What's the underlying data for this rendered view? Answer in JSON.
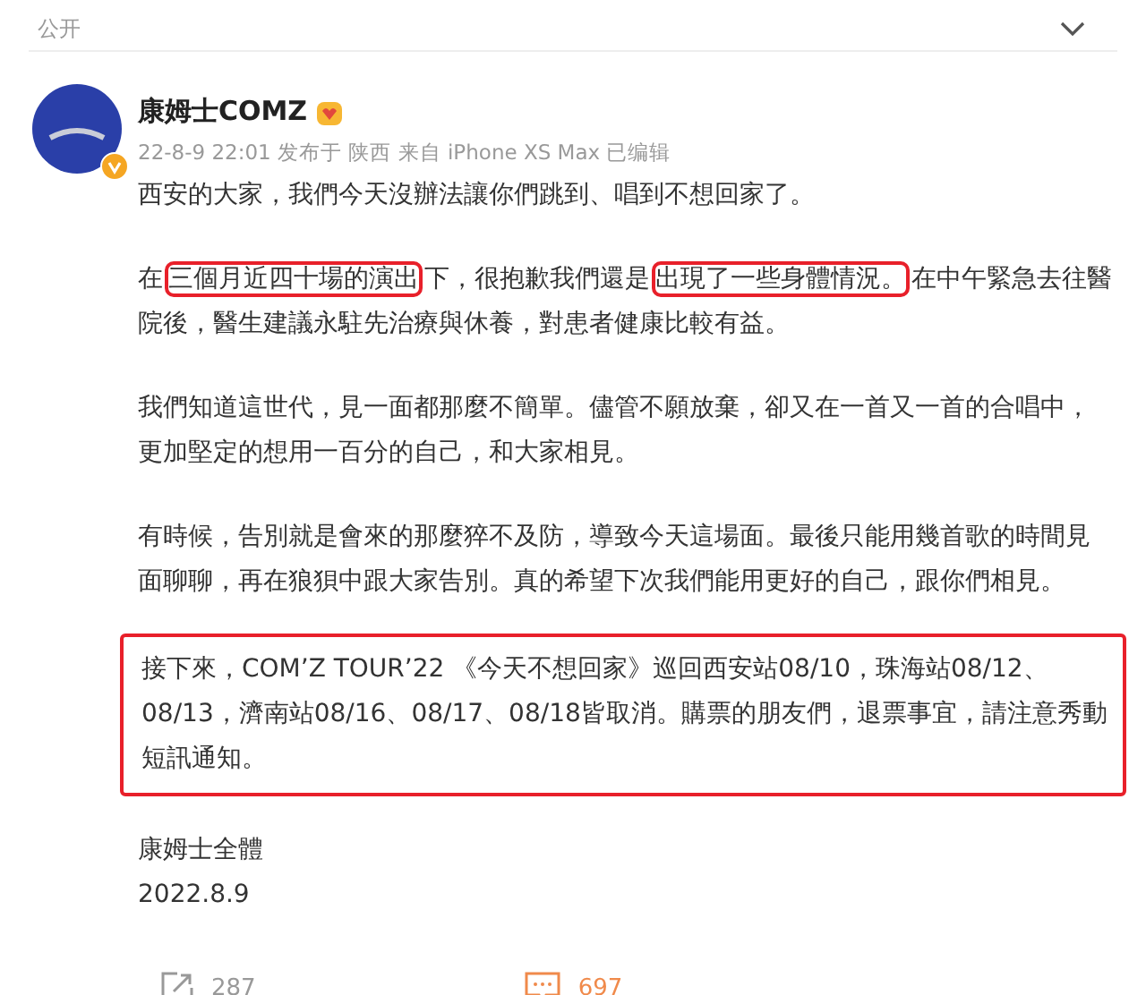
{
  "header": {
    "label": "公开"
  },
  "post": {
    "author": "康姆士COMZ",
    "meta": "22-8-9 22:01 发布于 陕西 来自 iPhone XS Max 已编辑",
    "paragraphs": [
      {
        "boxed": false,
        "segments": [
          {
            "text": "西安的大家，我們今天沒辦法讓你們跳到、唱到不想回家了。",
            "boxed": false
          }
        ]
      },
      {
        "boxed": false,
        "segments": [
          {
            "text": "在",
            "boxed": false
          },
          {
            "text": "三個月近四十場的演出",
            "boxed": true
          },
          {
            "text": "下，很抱歉我們還是",
            "boxed": false
          },
          {
            "text": "出現了一些身體情況。",
            "boxed": true
          },
          {
            "text": "在中午緊急去往醫院後，醫生建議永駐先治療與休養，對患者健康比較有益。",
            "boxed": false
          }
        ]
      },
      {
        "boxed": false,
        "segments": [
          {
            "text": "我們知道這世代，見一面都那麼不簡單。儘管不願放棄，卻又在一首又一首的合唱中，更加堅定的想用一百分的自己，和大家相見。",
            "boxed": false
          }
        ]
      },
      {
        "boxed": false,
        "segments": [
          {
            "text": "有時候，告別就是會來的那麼猝不及防，導致今天這場面。最後只能用幾首歌的時間見面聊聊，再在狼狽中跟大家告別。真的希望下次我們能用更好的自己，跟你們相見。",
            "boxed": false
          }
        ]
      },
      {
        "boxed": true,
        "segments": [
          {
            "text": "接下來，COM’Z TOUR’22 《今天不想回家》巡回西安站08/10，珠海站08/12、08/13，濟南站08/16、08/17、08/18皆取消。購票的朋友們，退票事宜，請注意秀動短訊通知。",
            "boxed": false
          }
        ]
      }
    ],
    "signature": [
      "康姆士全體",
      "2022.8.9"
    ],
    "actions": [
      {
        "kind": "share",
        "count": "287"
      },
      {
        "kind": "comment",
        "count": "697"
      }
    ]
  }
}
